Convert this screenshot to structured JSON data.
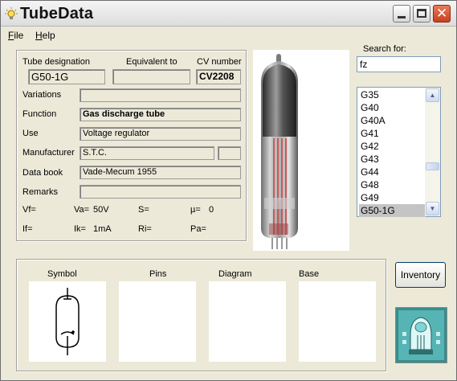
{
  "app": {
    "title": "TubeData"
  },
  "menu": {
    "file_u": "F",
    "file_rest": "ile",
    "help_u": "H",
    "help_rest": "elp"
  },
  "details": {
    "tube_designation_label": "Tube designation",
    "tube_designation": "G50-1G",
    "equivalent_to_label": "Equivalent to",
    "equivalent_to": "",
    "cv_number_label": "CV number",
    "cv_number": "CV2208",
    "variations_label": "Variations",
    "variations": "",
    "function_label": "Function",
    "function": "Gas discharge tube",
    "use_label": "Use",
    "use": "Voltage regulator",
    "manufacturer_label": "Manufacturer",
    "manufacturer": "S.T.C.",
    "manufacturer_extra": "",
    "data_book_label": "Data book",
    "data_book": "Vade-Mecum 1955",
    "remarks_label": "Remarks",
    "remarks": ""
  },
  "params": {
    "vf_label": "Vf=",
    "vf": "",
    "va_label": "Va=",
    "va": "50V",
    "s_label": "S=",
    "s": "",
    "mu_label": "µ=",
    "mu": "0",
    "if_label": "If=",
    "if": "",
    "ik_label": "Ik=",
    "ik": "1mA",
    "ri_label": "Ri=",
    "ri": "",
    "pa_label": "Pa=",
    "pa": ""
  },
  "search": {
    "label": "Search for:",
    "value": "fz"
  },
  "tube_list": {
    "items": [
      "G35",
      "G40",
      "G40A",
      "G41",
      "G42",
      "G43",
      "G44",
      "G48",
      "G49",
      "G50-1G"
    ],
    "selected": "G50-1G"
  },
  "bottom": {
    "symbol_label": "Symbol",
    "pins_label": "Pins",
    "diagram_label": "Diagram",
    "base_label": "Base",
    "inventory_label": "Inventory"
  },
  "icons": {
    "app": "lightbulb-icon",
    "minimize": "minimize-icon",
    "maximize": "maximize-icon",
    "close": "close-icon",
    "scroll_up": "scroll-up-icon",
    "scroll_down": "scroll-down-icon"
  },
  "colors": {
    "window_bg": "#ece9d8",
    "close_button": "#d4502c",
    "selection": "#c4c4c4",
    "input_border": "#7f9db9"
  }
}
